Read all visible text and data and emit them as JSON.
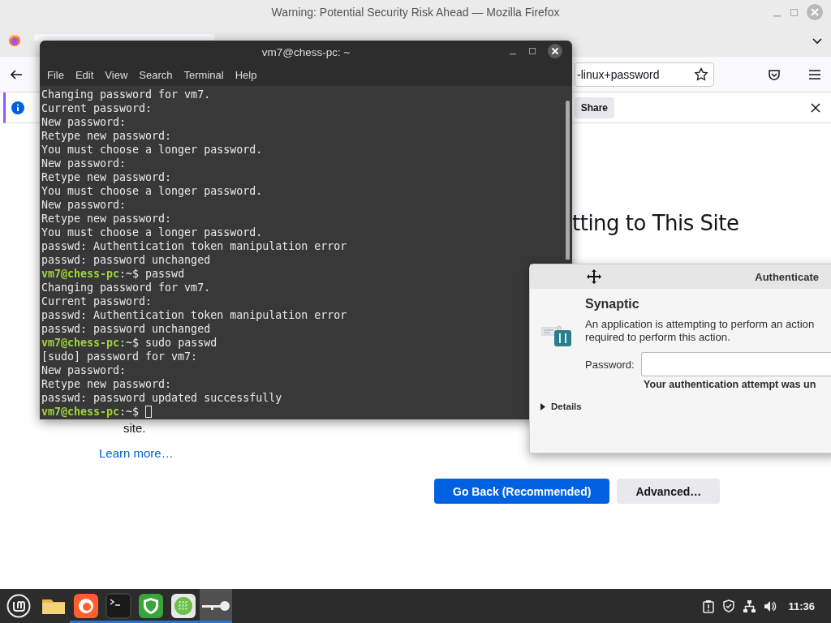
{
  "firefox": {
    "title": "Warning: Potential Security Risk Ahead — Mozilla Firefox",
    "url_text": "-linux+password",
    "notification_button": "Share",
    "heading": "tting to This Site",
    "body_end": "site.",
    "learn_more": "Learn more…",
    "buttons": [
      {
        "label": "Go Back (Recommended)",
        "kind": "primary"
      },
      {
        "label": "Advanced…",
        "kind": "secondary"
      }
    ]
  },
  "terminal": {
    "title": "vm7@chess-pc: ~",
    "menu": [
      "File",
      "Edit",
      "View",
      "Search",
      "Terminal",
      "Help"
    ],
    "lines": [
      {
        "kind": "output",
        "text": "Changing password for vm7."
      },
      {
        "kind": "output",
        "text": "Current password:"
      },
      {
        "kind": "output",
        "text": "New password:"
      },
      {
        "kind": "output",
        "text": "Retype new password:"
      },
      {
        "kind": "output",
        "text": "You must choose a longer password."
      },
      {
        "kind": "output",
        "text": "New password:"
      },
      {
        "kind": "output",
        "text": "Retype new password:"
      },
      {
        "kind": "output",
        "text": "You must choose a longer password."
      },
      {
        "kind": "output",
        "text": "New password:"
      },
      {
        "kind": "output",
        "text": "Retype new password:"
      },
      {
        "kind": "output",
        "text": "You must choose a longer password."
      },
      {
        "kind": "output",
        "text": "passwd: Authentication token manipulation error"
      },
      {
        "kind": "output",
        "text": "passwd: password unchanged"
      },
      {
        "kind": "prompt",
        "prompt": "vm7@chess-pc",
        "text": ":~$ passwd"
      },
      {
        "kind": "output",
        "text": "Changing password for vm7."
      },
      {
        "kind": "output",
        "text": "Current password:"
      },
      {
        "kind": "output",
        "text": "passwd: Authentication token manipulation error"
      },
      {
        "kind": "output",
        "text": "passwd: password unchanged"
      },
      {
        "kind": "prompt",
        "prompt": "vm7@chess-pc",
        "text": ":~$ sudo passwd"
      },
      {
        "kind": "output",
        "text": "[sudo] password for vm7:"
      },
      {
        "kind": "output",
        "text": "New password:"
      },
      {
        "kind": "output",
        "text": "Retype new password:"
      },
      {
        "kind": "output",
        "text": "passwd: password updated successfully"
      },
      {
        "kind": "prompt",
        "prompt": "vm7@chess-pc",
        "text": ":~$ ",
        "cursor": true
      }
    ]
  },
  "auth_dialog": {
    "title": "Authenticate",
    "app": "Synaptic",
    "message_lines": [
      "An application is attempting to perform an action",
      "required to perform this action."
    ],
    "password_label": "Password:",
    "error": "Your authentication attempt was un",
    "details": {
      "label": "Details",
      "expanded": false
    }
  },
  "taskbar": {
    "launchers": [
      {
        "kind": "folder",
        "running": false,
        "selected": false
      },
      {
        "kind": "firefox",
        "running": true,
        "selected": false
      },
      {
        "kind": "terminal",
        "running": true,
        "selected": false
      },
      {
        "kind": "shield",
        "running": true,
        "selected": false
      },
      {
        "kind": "grid",
        "running": true,
        "selected": false
      },
      {
        "kind": "key",
        "running": true,
        "selected": true
      }
    ],
    "clock": "11:36"
  }
}
